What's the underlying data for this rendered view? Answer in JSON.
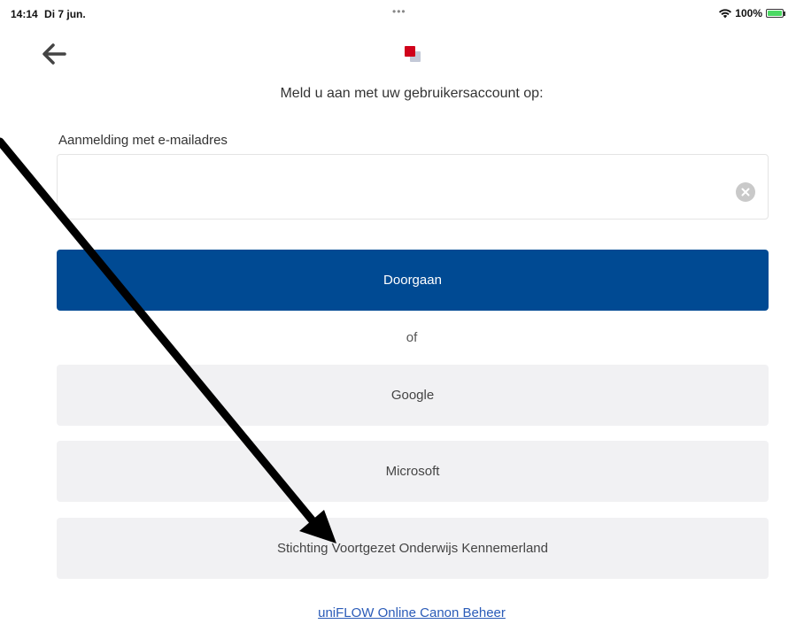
{
  "status_bar": {
    "time": "14:14",
    "date": "Di 7 jun.",
    "battery_text": "100%",
    "battery_level": 1.0,
    "icons": [
      "wifi-icon",
      "battery-charging-icon"
    ]
  },
  "header": {
    "back_icon": "arrow-left-icon",
    "logo": "canon-uniflow-logo"
  },
  "subtitle": "Meld u aan met uw gebruikersaccount op:",
  "email": {
    "label": "Aanmelding met e-mailadres",
    "value": "",
    "placeholder": "",
    "clear_icon": "clear-circle-icon"
  },
  "continue_label": "Doorgaan",
  "or_text": "of",
  "providers": {
    "google": "Google",
    "microsoft": "Microsoft",
    "school": "Stichting Voortgezet Onderwijs Kennemerland"
  },
  "footer_link": "uniFLOW Online Canon Beheer",
  "colors": {
    "primary": "#004a93",
    "secondary_button": "#f1f1f3",
    "link": "#2a5bb8",
    "logo_red": "#d0021b"
  }
}
